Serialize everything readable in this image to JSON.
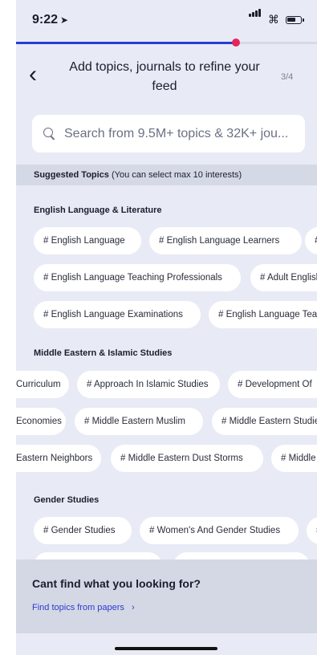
{
  "status": {
    "time": "9:22",
    "location_icon": "location-arrow-icon"
  },
  "progress": {
    "fraction": 0.73
  },
  "header": {
    "title": "Add topics, journals to refine your feed",
    "step": "3/4",
    "back_icon": "chevron-left-icon"
  },
  "search": {
    "placeholder": "Search from 9.5M+ topics & 32K+ jou..."
  },
  "suggested": {
    "bold": "Suggested Topics",
    "note": "(You can select max 10 interests)"
  },
  "sections": [
    {
      "title": "English Language & Literature",
      "rows": [
        [
          "# English Language",
          "# English Language Learners",
          "# English"
        ],
        [
          "# English Language Teaching Professionals",
          "# Adult English"
        ],
        [
          "# English Language Examinations",
          "# English Language Teaching"
        ]
      ]
    },
    {
      "title": "Middle Eastern & Islamic Studies",
      "rows": [
        [
          "Curriculum",
          "# Approach In Islamic Studies",
          "# Development Of"
        ],
        [
          "Economies",
          "# Middle Eastern Muslim",
          "# Middle Eastern Studies"
        ],
        [
          "Eastern Neighbors",
          "# Middle Eastern Dust Storms",
          "# Middle"
        ]
      ]
    },
    {
      "title": "Gender Studies",
      "rows": [
        [
          "# Gender Studies",
          "# Women's And Gender Studies",
          "#"
        ]
      ]
    }
  ],
  "bottom": {
    "question": "Cant find what you looking for?",
    "link": "Find topics from papers",
    "link_icon": "chevron-right-icon"
  },
  "colors": {
    "accent": "#2b3bd1",
    "progress_dot": "#e5255b",
    "background": "#e8ebf5"
  }
}
